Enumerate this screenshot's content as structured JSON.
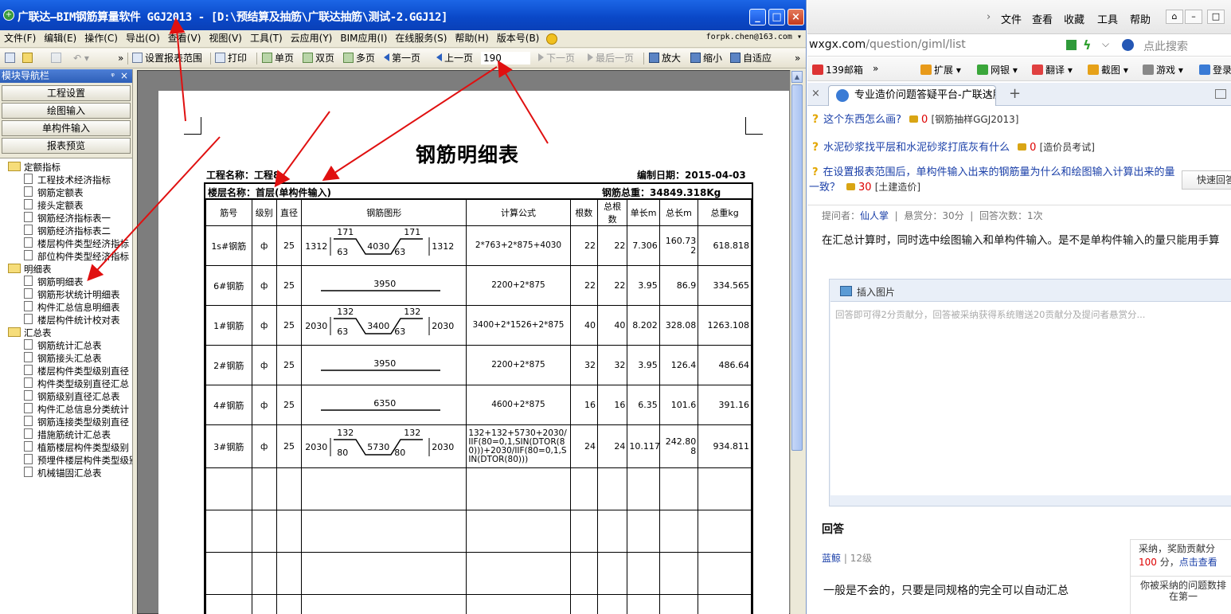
{
  "app": {
    "title": "广联达—BIM钢筋算量软件 GGJ2013 - [D:\\预结算及抽筋\\广联达抽筋\\测试-2.GGJ12]",
    "controls": {
      "minimize": "_",
      "maximize": "□",
      "close": "×"
    }
  },
  "menu": {
    "items": [
      "文件(F)",
      "编辑(E)",
      "操作(C)",
      "导出(O)",
      "查看(V)",
      "视图(V)",
      "工具(T)",
      "云应用(Y)",
      "BIM应用(I)",
      "在线服务(S)",
      "帮助(H)",
      "版本号(B)"
    ],
    "user": "forpk.chen@163.com ▾"
  },
  "toolbar": {
    "set_range": "设置报表范围",
    "print": "打印",
    "single": "单页",
    "double": "双页",
    "multi": "多页",
    "first": "第一页",
    "prev": "上一页",
    "page": "190",
    "next": "下一页",
    "last": "最后一页",
    "zoom_in": "放大",
    "zoom_out": "缩小",
    "fit": "自适应",
    "more": "»"
  },
  "nav": {
    "title": "模块导航栏",
    "pin": "ᵠ",
    "close": "×",
    "buttons": [
      "工程设置",
      "绘图输入",
      "单构件输入",
      "报表预览"
    ],
    "groups": [
      {
        "label": "定额指标",
        "items": [
          "工程技术经济指标",
          "钢筋定额表",
          "接头定额表",
          "钢筋经济指标表一",
          "钢筋经济指标表二",
          "楼层构件类型经济指标",
          "部位构件类型经济指标"
        ]
      },
      {
        "label": "明细表",
        "items": [
          "钢筋明细表",
          "钢筋形状统计明细表",
          "构件汇总信息明细表",
          "楼层构件统计校对表"
        ]
      },
      {
        "label": "汇总表",
        "items": [
          "钢筋统计汇总表",
          "钢筋接头汇总表",
          "楼层构件类型级别直径",
          "构件类型级别直径汇总",
          "钢筋级别直径汇总表",
          "构件汇总信息分类统计",
          "钢筋连接类型级别直径",
          "措施筋统计汇总表",
          "植筋楼层构件类型级别",
          "预埋件楼层构件类型级别",
          "机械锚固汇总表"
        ]
      }
    ]
  },
  "report": {
    "title": "钢筋明细表",
    "project_label": "工程名称：工程8",
    "date_label": "编制日期：2015-04-03",
    "floor_label": "楼层名称：首层(单构件输入)",
    "weight_label": "钢筋总重：34849.318Kg",
    "headers": [
      "筋号",
      "级别",
      "直径",
      "钢筋图形",
      "计算公式",
      "根数",
      "总根数",
      "单长m",
      "总长m",
      "总重kg"
    ],
    "rows": [
      {
        "name": "1s#钢筋",
        "grade": "ф",
        "dia": "25",
        "shape": {
          "type": "double-bent",
          "left": "1312",
          "top_l": "171",
          "bot_l": "63",
          "mid": "4030",
          "top_r": "171",
          "bot_r": "63",
          "right": "1312"
        },
        "formula": "2*763+2*875+4030",
        "count": "22",
        "total": "22",
        "unit": "7.306",
        "length": "160.732",
        "weight": "618.818"
      },
      {
        "name": "6#钢筋",
        "grade": "ф",
        "dia": "25",
        "shape": {
          "type": "straight",
          "mid": "3950"
        },
        "formula": "2200+2*875",
        "count": "22",
        "total": "22",
        "unit": "3.95",
        "length": "86.9",
        "weight": "334.565"
      },
      {
        "name": "1#钢筋",
        "grade": "ф",
        "dia": "25",
        "shape": {
          "type": "double-bent",
          "left": "2030",
          "top_l": "132",
          "bot_l": "63",
          "mid": "3400",
          "top_r": "132",
          "bot_r": "63",
          "right": "2030"
        },
        "formula": "3400+2*1526+2*875",
        "count": "40",
        "total": "40",
        "unit": "8.202",
        "length": "328.08",
        "weight": "1263.108"
      },
      {
        "name": "2#钢筋",
        "grade": "ф",
        "dia": "25",
        "shape": {
          "type": "straight",
          "mid": "3950"
        },
        "formula": "2200+2*875",
        "count": "32",
        "total": "32",
        "unit": "3.95",
        "length": "126.4",
        "weight": "486.64"
      },
      {
        "name": "4#钢筋",
        "grade": "ф",
        "dia": "25",
        "shape": {
          "type": "straight",
          "mid": "6350"
        },
        "formula": "4600+2*875",
        "count": "16",
        "total": "16",
        "unit": "6.35",
        "length": "101.6",
        "weight": "391.16"
      },
      {
        "name": "3#钢筋",
        "grade": "ф",
        "dia": "25",
        "shape": {
          "type": "double-bent",
          "left": "2030",
          "top_l": "132",
          "bot_l": "80",
          "mid": "5730",
          "top_r": "132",
          "bot_r": "80",
          "right": "2030"
        },
        "formula": "132+132+5730+2030/IIF(80=0,1,SIN(DTOR(80)))+2030/IIF(80=0,1,SIN(DTOR(80)))",
        "count": "24",
        "total": "24",
        "unit": "10.117",
        "length": "242.808",
        "weight": "934.811"
      }
    ]
  },
  "browser": {
    "menu": [
      "文件",
      "查看",
      "收藏",
      "工具",
      "帮助"
    ],
    "back": "›",
    "url_host": "wxgx.com",
    "url_path": "/question/giml/list",
    "search_placeholder": "点此搜索",
    "favorites": [
      "139邮箱",
      "»",
      "扩展",
      "网银",
      "翻译",
      "截图",
      "游戏",
      "登录"
    ],
    "tab_title": "专业造价问题答疑平台-广联达服务新干线",
    "tab_close": "×",
    "new_tab": "+",
    "questions": [
      {
        "title": "这个东西怎么画?",
        "coins": "0",
        "cat": "[钢筋抽样GGJ2013]"
      },
      {
        "title": "水泥砂浆找平层和水泥砂浆打底灰有什么",
        "coins": "0",
        "cat": "[造价员考试]"
      }
    ],
    "long_question": {
      "title": "在设置报表范围后，单构件输入出来的钢筋量为什么和绘图输入计算出来的量一致？",
      "coins": "30",
      "cat": "[土建造价]"
    },
    "fast_button": "快速回答",
    "info": {
      "asker_label": "提问者：",
      "asker": "仙人掌",
      "bounty": "悬赏分：30分",
      "answers": "回答次数：1次"
    },
    "question_text": "在汇总计算时，同时选中绘图输入和单构件输入。是不是单构件输入的量只能用手算",
    "insert_image": "插入图片",
    "answer_placeholder": "回答即可得2分贡献分，回答被采纳获得系统赠送20贡献分及提问者悬赏分...",
    "answer_heading": "回答",
    "answer_user": "蓝鲸",
    "answer_level": "12级",
    "answer_text": "一般是不会的，只要是同规格的完全可以自动汇总",
    "reward": {
      "line1": "采纳，奖励贡献分",
      "points": "100",
      "line2_suffix": "分，",
      "link": "点击查看",
      "rank_line1": "你被采纳的问题数排",
      "rank_line2": "在第一"
    }
  }
}
